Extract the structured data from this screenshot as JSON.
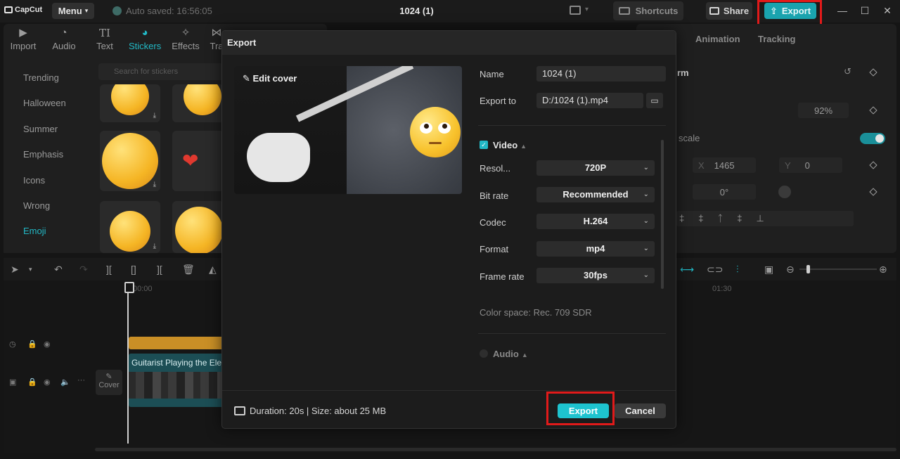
{
  "titlebar": {
    "app_name": "CapCut",
    "menu_label": "Menu",
    "autosave": "Auto saved: 16:56:05",
    "doc_title": "1024 (1)",
    "shortcuts_label": "Shortcuts",
    "share_label": "Share",
    "export_label": "Export",
    "minimize": "—",
    "maximize": "☐",
    "close": "✕"
  },
  "toolbar": {
    "items": [
      {
        "label": "Import",
        "icon": "import-icon"
      },
      {
        "label": "Audio",
        "icon": "audio-icon"
      },
      {
        "label": "Text",
        "icon": "text-icon"
      },
      {
        "label": "Stickers",
        "icon": "stickers-icon"
      },
      {
        "label": "Effects",
        "icon": "effects-icon"
      },
      {
        "label": "Tra",
        "icon": "transitions-icon"
      }
    ],
    "active": "Stickers"
  },
  "stickers": {
    "search_placeholder": "Search for stickers",
    "categories": [
      "Trending",
      "Halloween",
      "Summer",
      "Emphasis",
      "Icons",
      "Wrong",
      "Emoji"
    ],
    "active_category": "Emoji"
  },
  "right_panel": {
    "tabs": [
      "Animation",
      "Tracking"
    ],
    "section_suffix": "rm",
    "scale_value": "92%",
    "uniform_scale": "scale",
    "x_label": "X",
    "x_value": "1465",
    "y_label": "Y",
    "y_value": "0",
    "rotation": "0°"
  },
  "timeline": {
    "time_start": "00:00",
    "time_mark": "01:30",
    "clip_label": "Guitarist Playing the Ele",
    "cover_label": "Cover"
  },
  "dialog": {
    "title": "Export",
    "edit_cover": "Edit cover",
    "name_label": "Name",
    "name_value": "1024 (1)",
    "export_to_label": "Export to",
    "export_to_value": "D:/1024 (1).mp4",
    "video_section": "Video",
    "fields": [
      {
        "label": "Resol...",
        "value": "720P"
      },
      {
        "label": "Bit rate",
        "value": "Recommended"
      },
      {
        "label": "Codec",
        "value": "H.264"
      },
      {
        "label": "Format",
        "value": "mp4"
      },
      {
        "label": "Frame rate",
        "value": "30fps"
      }
    ],
    "color_space": "Color space: Rec. 709 SDR",
    "audio_section": "Audio",
    "footer_info": "Duration: 20s | Size: about 25 MB",
    "export_button": "Export",
    "cancel_button": "Cancel"
  },
  "colors": {
    "accent": "#22b9c6",
    "highlight": "#e11a1a"
  }
}
